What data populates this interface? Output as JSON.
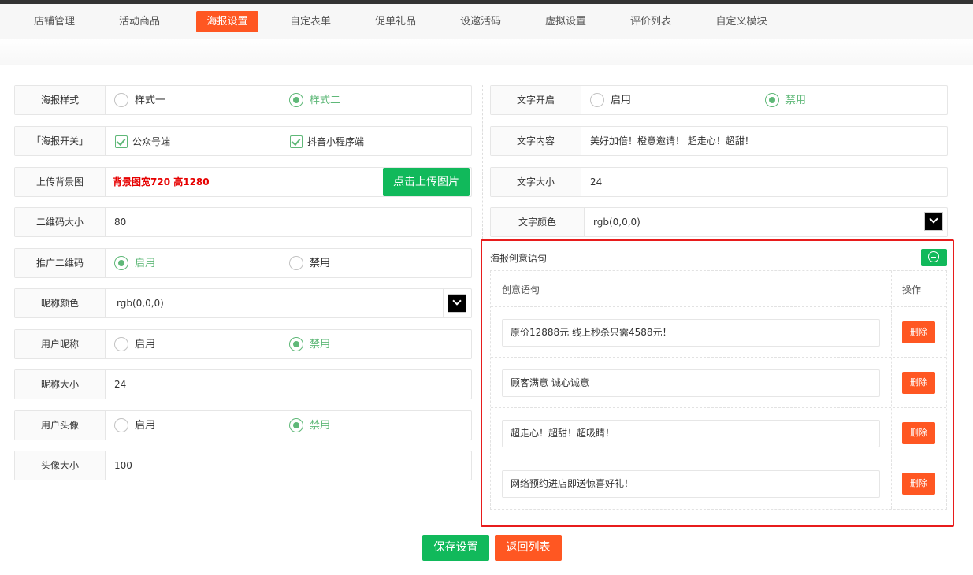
{
  "tabs": [
    {
      "label": "店铺管理",
      "active": false
    },
    {
      "label": "活动商品",
      "active": false
    },
    {
      "label": "海报设置",
      "active": true
    },
    {
      "label": "自定表单",
      "active": false
    },
    {
      "label": "促单礼品",
      "active": false
    },
    {
      "label": "设邀活码",
      "active": false
    },
    {
      "label": "虚拟设置",
      "active": false
    },
    {
      "label": "评价列表",
      "active": false
    },
    {
      "label": "自定义模块",
      "active": false
    }
  ],
  "left": {
    "poster_style": {
      "label": "海报样式",
      "option1": "样式一",
      "option2": "样式二",
      "selected": "样式二"
    },
    "poster_switch": {
      "label": "「海报开关」",
      "option1": "公众号端",
      "option2": "抖音小程序端"
    },
    "upload_bg": {
      "label": "上传背景图",
      "hint": "背景图宽720 高1280",
      "button": "点击上传图片"
    },
    "qr_size": {
      "label": "二维码大小",
      "value": "80"
    },
    "promo_qr": {
      "label": "推广二维码",
      "option1": "启用",
      "option2": "禁用",
      "selected": "启用"
    },
    "nick_color": {
      "label": "昵称颜色",
      "value": "rgb(0,0,0)",
      "color": "#000000"
    },
    "user_nick": {
      "label": "用户昵称",
      "option1": "启用",
      "option2": "禁用",
      "selected": "禁用"
    },
    "nick_size": {
      "label": "昵称大小",
      "value": "24"
    },
    "user_avatar": {
      "label": "用户头像",
      "option1": "启用",
      "option2": "禁用",
      "selected": "禁用"
    },
    "avatar_size": {
      "label": "头像大小",
      "value": "100"
    }
  },
  "right": {
    "text_enable": {
      "label": "文字开启",
      "option1": "启用",
      "option2": "禁用",
      "selected": "禁用"
    },
    "text_content": {
      "label": "文字内容",
      "value": "美好加倍！橙意邀请！ 超走心！超甜！"
    },
    "text_size": {
      "label": "文字大小",
      "value": "24"
    },
    "text_color": {
      "label": "文字颜色",
      "value": "rgb(0,0,0)",
      "color": "#000000"
    }
  },
  "phrases": {
    "title": "海报创意语句",
    "col_phrase": "创意语句",
    "col_action": "操作",
    "delete_label": "删除",
    "rows": [
      "原价12888元 线上秒杀只需4588元！",
      "顾客满意 诚心诚意",
      "超走心！超甜！超吸睛！",
      "网络预约进店即送惊喜好礼！"
    ]
  },
  "footer": {
    "save": "保存设置",
    "back": "返回列表"
  },
  "colors": {
    "accent": "#ff5722",
    "green": "#11b95b",
    "radio_on": "#5fb878",
    "highlight_border": "#e81c1c"
  }
}
